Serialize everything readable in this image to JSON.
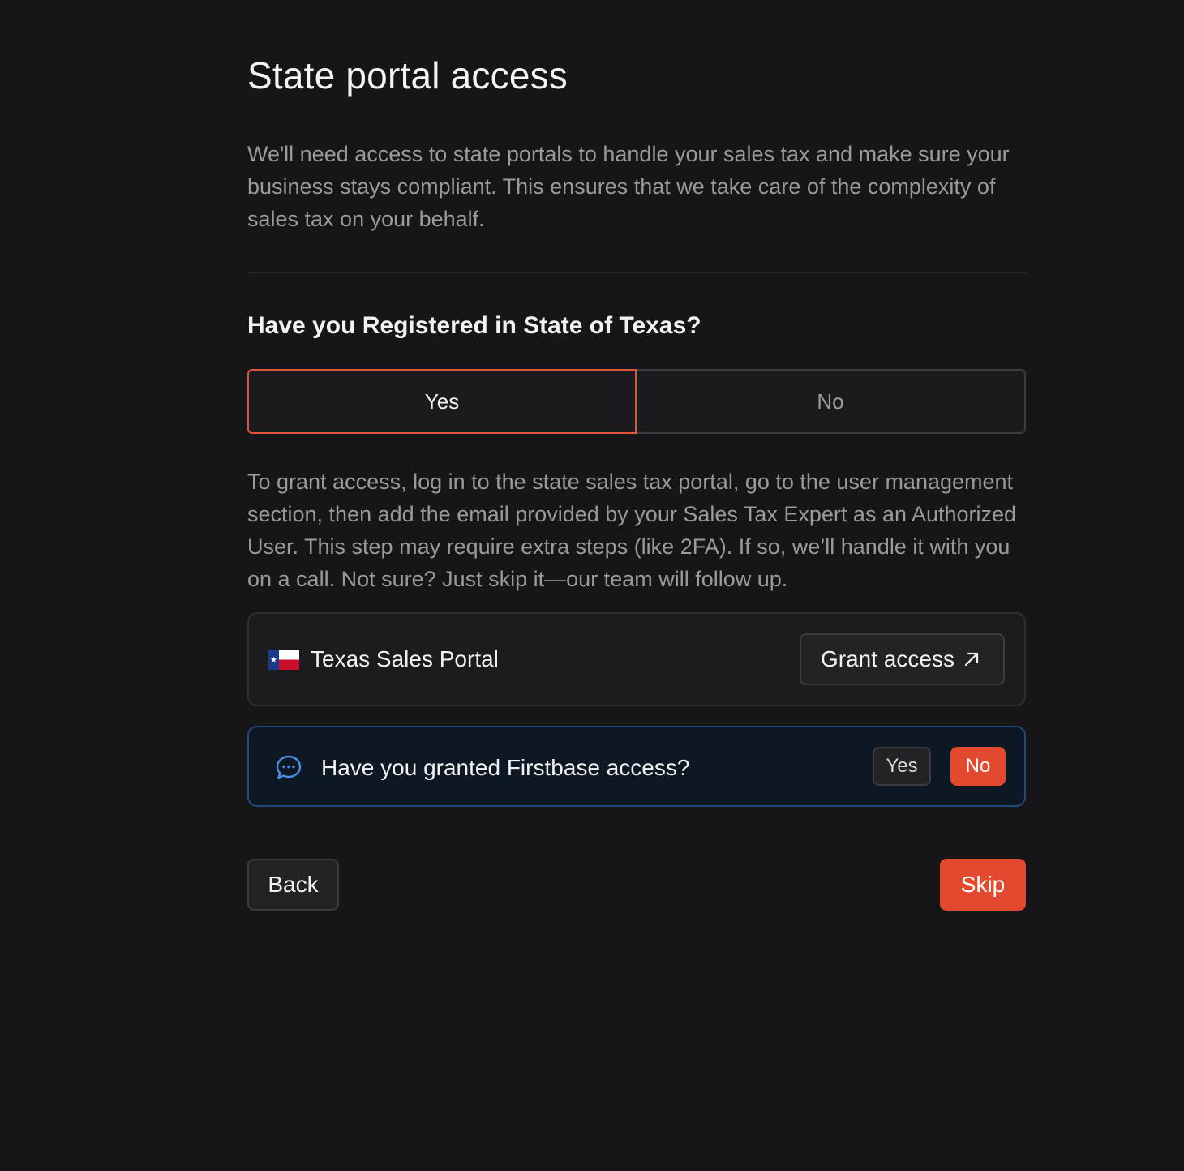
{
  "page": {
    "title": "State portal access",
    "intro": "We'll need access to state portals to handle your sales tax and make sure your business stays compliant. This ensures that we take care of the complexity of sales tax on your behalf."
  },
  "registration": {
    "question": "Have you Registered in State of Texas?",
    "options": [
      "Yes",
      "No"
    ],
    "selected": "Yes",
    "selected_color": "#e0543a"
  },
  "instructions": "To grant access, log in to the state sales tax portal, go to the user management section, then add the email provided by your Sales Tax Expert as an Authorized User. This step may require extra steps (like 2FA). If so, we’ll handle it with you on a call. Not sure? Just skip it—our team will follow up.",
  "portal": {
    "flag_icon": "texas-flag-icon",
    "name": "Texas Sales Portal",
    "grant_label": "Grant access",
    "grant_icon": "arrow-up-right-icon"
  },
  "confirmation": {
    "icon": "chat-bubble-icon",
    "question": "Have you granted Firstbase access?",
    "yes_label": "Yes",
    "no_label": "No"
  },
  "footer": {
    "back_label": "Back",
    "skip_label": "Skip"
  },
  "colors": {
    "accent": "#e2492e",
    "info_border": "#1f4a7e",
    "background": "#161618"
  }
}
